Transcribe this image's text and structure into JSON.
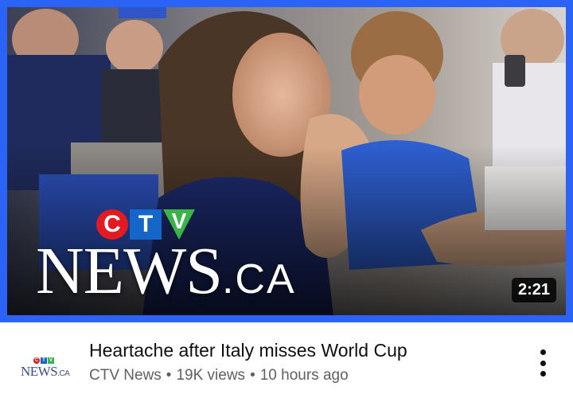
{
  "thumbnail": {
    "logo_letters": [
      "C",
      "T",
      "V"
    ],
    "logo_wordmark": "NEWS",
    "logo_suffix": ".CA",
    "duration": "2:21",
    "border_color": "#2a63f5"
  },
  "video": {
    "title": "Heartache after Italy misses World Cup",
    "channel": "CTV News",
    "views": "19K views",
    "age": "10 hours ago",
    "separator": "•"
  },
  "avatar": {
    "letters": [
      "C",
      "T",
      "V"
    ],
    "wordmark": "NEWS",
    "suffix": ".CA"
  },
  "icons": {
    "more": "more-vert-icon"
  },
  "colors": {
    "ctv_red": "#e21b23",
    "ctv_blue": "#1467c9",
    "ctv_green": "#3ab34a",
    "title_text": "#0f0f0f",
    "meta_text": "#606060"
  }
}
